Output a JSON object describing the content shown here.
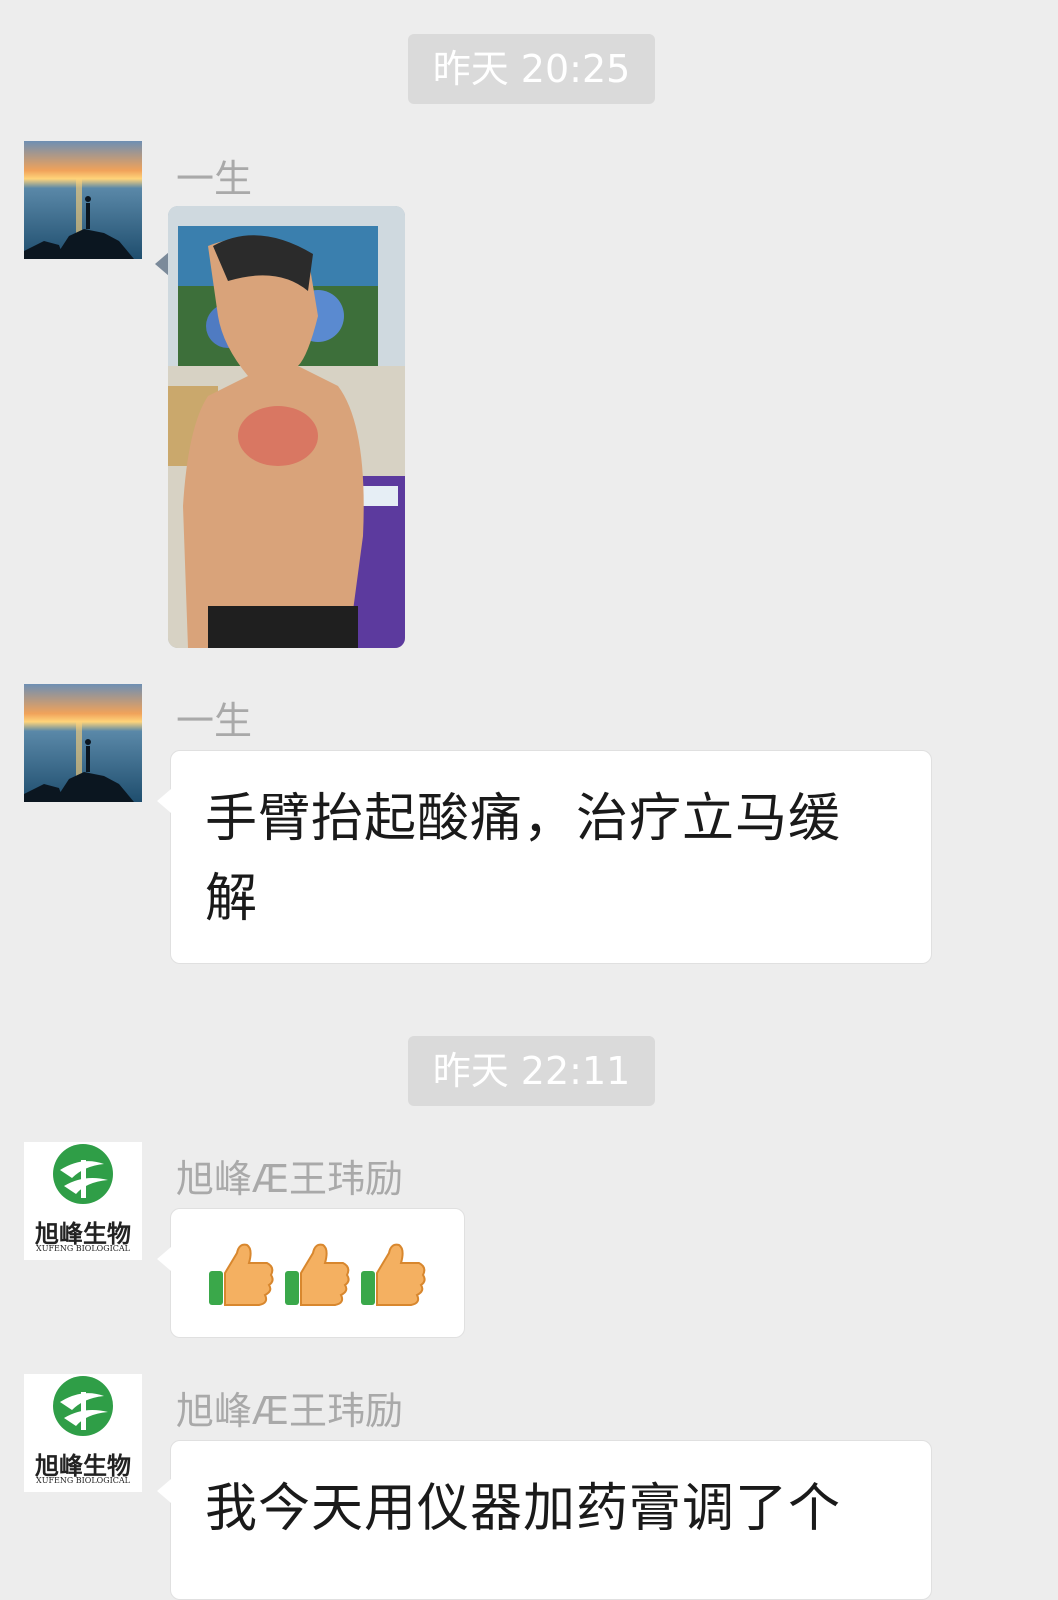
{
  "chat": {
    "timestamps": [
      {
        "label": "昨天 20:25"
      },
      {
        "label": "昨天 22:11"
      }
    ],
    "messages": [
      {
        "sender": "一生",
        "type": "image",
        "image_desc": "photo-of-man-shoulder-treatment"
      },
      {
        "sender": "一生",
        "type": "text",
        "text_line1": "手臂抬起酸痛，治疗立马缓",
        "text_line2": "解"
      },
      {
        "sender": "旭峰Æ王玮励",
        "type": "emoji",
        "emoji": [
          "thumbs-up",
          "thumbs-up",
          "thumbs-up"
        ]
      },
      {
        "sender": "旭峰Æ王玮励",
        "type": "text",
        "text_line1": "我今天用仪器加药膏调了个"
      }
    ],
    "logo": {
      "brand_cn": "旭峰生物",
      "brand_en": "XUFENG BIOLOGICAL"
    }
  },
  "colors": {
    "background": "#ededed",
    "bubble": "#ffffff",
    "timestamp_bg": "#dadada",
    "name_text": "#a9a9a9",
    "logo_green": "#2f9e47"
  }
}
